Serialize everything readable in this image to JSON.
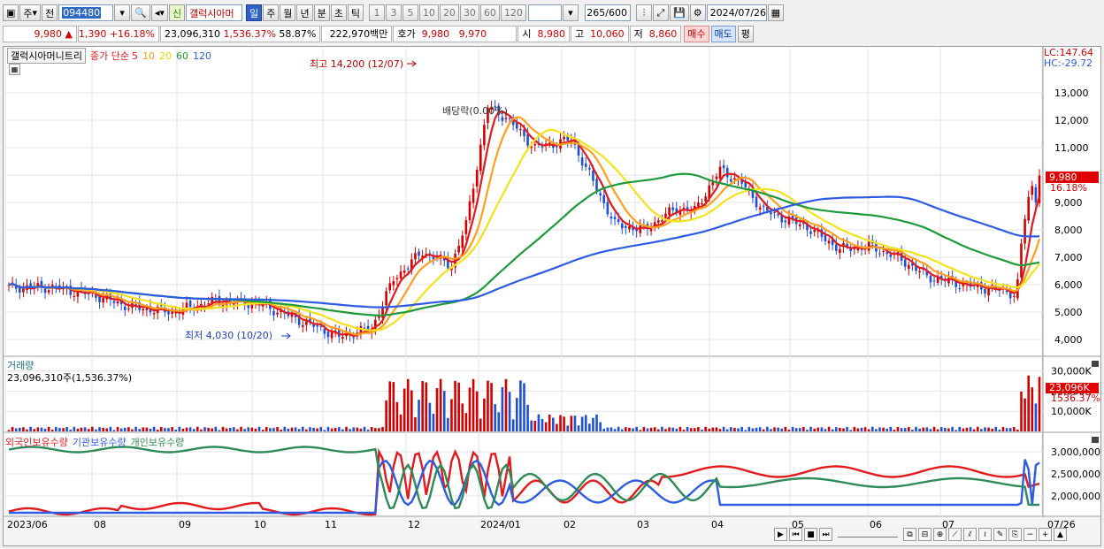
{
  "toolbar": {
    "market_sel": "주",
    "prev_label": "전",
    "code": "094480",
    "new_badge": "신",
    "stock_name": "갤럭시아머",
    "periods": [
      "일",
      "주",
      "월",
      "년",
      "분",
      "초",
      "틱"
    ],
    "selected_period": "일",
    "intervals": [
      "1",
      "3",
      "5",
      "10",
      "20",
      "30",
      "60",
      "120"
    ],
    "count": "265",
    "count_total": "/600",
    "date": "2024/07/26"
  },
  "quote": {
    "price": "9,980",
    "change": "1,390",
    "change_pct": "+16.18%",
    "volume": "23,096,310",
    "volume_ratio": "1,536.37%",
    "turnover": "58.87%",
    "amount": "222,970백만",
    "hoga_label": "호가",
    "ask": "9,980",
    "bid": "9,970",
    "open_label": "시",
    "open": "8,980",
    "high_label": "고",
    "high": "10,060",
    "low_label": "저",
    "low": "8,860",
    "buy_label": "매수",
    "sell_label": "매도",
    "avg_label": "평"
  },
  "price_panel": {
    "title": "갤럭시아머니트리",
    "legend_label": "종가 단순",
    "ma": [
      {
        "period": "5",
        "color": "#e31a1c"
      },
      {
        "period": "10",
        "color": "#ff9f1c"
      },
      {
        "period": "20",
        "color": "#f2e31a"
      },
      {
        "period": "60",
        "color": "#1f9a3a"
      },
      {
        "period": "120",
        "color": "#2d5be3"
      }
    ],
    "lc": "LC:147.64",
    "hc": "HC:-29.72",
    "y_ticks": [
      "13,000",
      "12,000",
      "11,000",
      "10,000",
      "9,000",
      "8,000",
      "7,000",
      "6,000",
      "5,000",
      "4,000"
    ],
    "current_price": "9,980",
    "current_pct": "16.18%",
    "high_annotation": "최고 14,200 (12/07)",
    "low_annotation": "최저 4,030 (10/20)",
    "dividend_annotation": "배당락(0.00%)"
  },
  "volume_panel": {
    "title": "거래량",
    "value_text": "23,096,310주(1,536.37%)",
    "y_ticks": [
      "30,000K",
      "20,000K",
      "10,000K"
    ],
    "current": "23,096K",
    "current_pct": "1536.37%"
  },
  "holdings_panel": {
    "series": [
      {
        "name": "외국인보유수량",
        "color": "#e31a1c"
      },
      {
        "name": "기관보유수량",
        "color": "#2d5be3"
      },
      {
        "name": "개인보유수량",
        "color": "#2e8b57"
      }
    ],
    "y_ticks": [
      "3,000,000",
      "2,500,000",
      "2,000,000"
    ]
  },
  "x_axis": {
    "labels": [
      "2023/06",
      "08",
      "09",
      "10",
      "11",
      "12",
      "2024/01",
      "02",
      "03",
      "04",
      "05",
      "06",
      "07",
      "07/26"
    ]
  },
  "colors": {
    "up": "#d20000",
    "down": "#1f4fd6",
    "grid": "#e3e3e3"
  }
}
